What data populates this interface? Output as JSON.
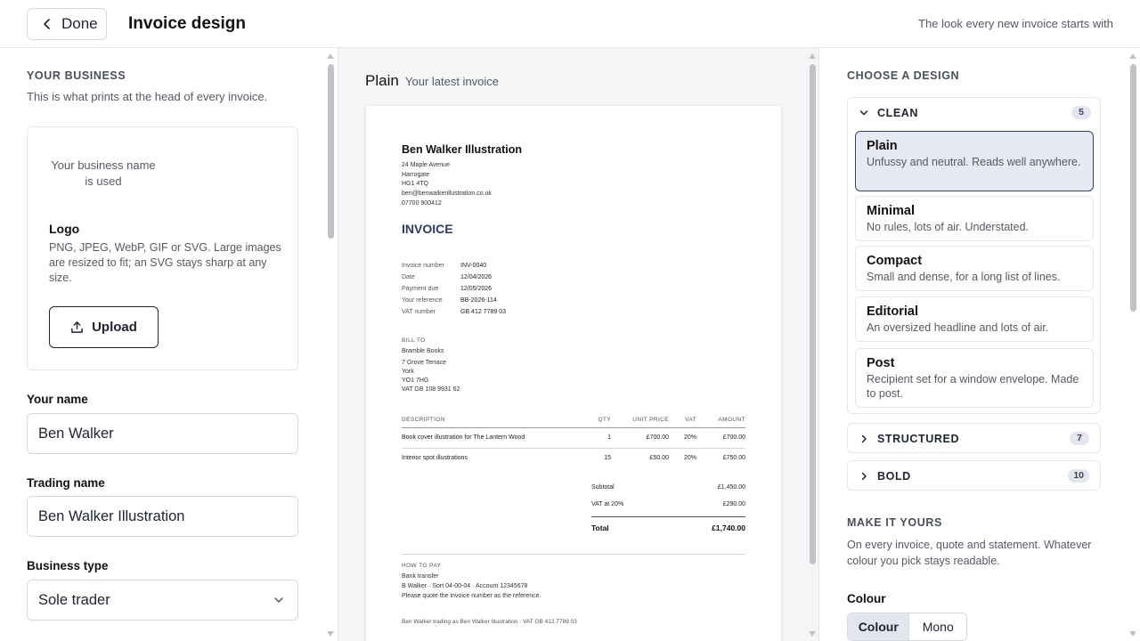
{
  "topbar": {
    "done_label": "Done",
    "title": "Invoice design",
    "subtitle": "The look every new invoice starts with"
  },
  "business": {
    "heading": "YOUR BUSINESS",
    "subheading": "This is what prints at the head of every invoice.",
    "logo_placeholder": "Your business name is used",
    "logo_title": "Logo",
    "logo_help": "PNG, JPEG, WebP, GIF or SVG. Large images are resized to fit; an SVG stays sharp at any size.",
    "upload_label": "Upload",
    "name_label": "Your name",
    "name_value": "Ben Walker",
    "trading_label": "Trading name",
    "trading_value": "Ben Walker Illustration",
    "type_label": "Business type",
    "type_value": "Sole trader"
  },
  "preview": {
    "design_name": "Plain",
    "caption": "Your latest invoice",
    "invoice": {
      "business_name": "Ben Walker Illustration",
      "address": [
        "24 Maple Avenue",
        "Harrogate",
        "HG1 4TQ",
        "ben@benwalkerillustration.co.uk",
        "07700 900412"
      ],
      "title": "INVOICE",
      "meta": [
        {
          "label": "Invoice number",
          "value": "INV-0040"
        },
        {
          "label": "Date",
          "value": "12/04/2026"
        },
        {
          "label": "Payment due",
          "value": "12/05/2026"
        },
        {
          "label": "Your reference",
          "value": "BB-2026-114"
        },
        {
          "label": "VAT number",
          "value": "GB 412 7789 03"
        }
      ],
      "bill_to_label": "BILL TO",
      "bill_to": [
        "Bramble Books",
        "7 Grove Terrace",
        "York",
        "YO1 7HG",
        "VAT GB 108 9931 62"
      ],
      "columns": [
        "DESCRIPTION",
        "QTY",
        "UNIT PRICE",
        "VAT",
        "AMOUNT"
      ],
      "lines": [
        {
          "desc": "Book cover illustration for The Lantern Wood",
          "qty": "1",
          "unit": "£700.00",
          "vat": "20%",
          "amount": "£700.00"
        },
        {
          "desc": "Interior spot illustrations",
          "qty": "15",
          "unit": "£50.00",
          "vat": "20%",
          "amount": "£750.00"
        }
      ],
      "subtotal_label": "Subtotal",
      "subtotal": "£1,450.00",
      "vat_label": "VAT at 20%",
      "vat": "£290.00",
      "total_label": "Total",
      "total": "£1,740.00",
      "pay_label": "HOW TO PAY",
      "pay_lines": [
        "Bank transfer",
        "B Walker · Sort 04-00-04 · Account 12345678",
        "Please quote the invoice number as the reference."
      ],
      "footer": "Ben Walker trading as Ben Walker Illustration · VAT GB 412 7789 03"
    }
  },
  "designs": {
    "heading": "CHOOSE A DESIGN",
    "groups": [
      {
        "name": "CLEAN",
        "count": "5"
      },
      {
        "name": "STRUCTURED",
        "count": "7"
      },
      {
        "name": "BOLD",
        "count": "10"
      }
    ],
    "items": [
      {
        "name": "Plain",
        "desc": "Unfussy and neutral. Reads well anywhere."
      },
      {
        "name": "Minimal",
        "desc": "No rules, lots of air. Understated."
      },
      {
        "name": "Compact",
        "desc": "Small and dense, for a long list of lines."
      },
      {
        "name": "Editorial",
        "desc": "An oversized headline and lots of air."
      },
      {
        "name": "Post",
        "desc": "Recipient set for a window envelope. Made to post."
      }
    ]
  },
  "customize": {
    "heading": "MAKE IT YOURS",
    "subheading": "On every invoice, quote and statement. Whatever colour you pick stays readable.",
    "colour_label": "Colour",
    "options": [
      "Colour",
      "Mono"
    ]
  },
  "colors": {
    "accent": "#2e3a62",
    "selected_bg": "#e7e9f3",
    "badge_bg": "#e3e6ef"
  }
}
